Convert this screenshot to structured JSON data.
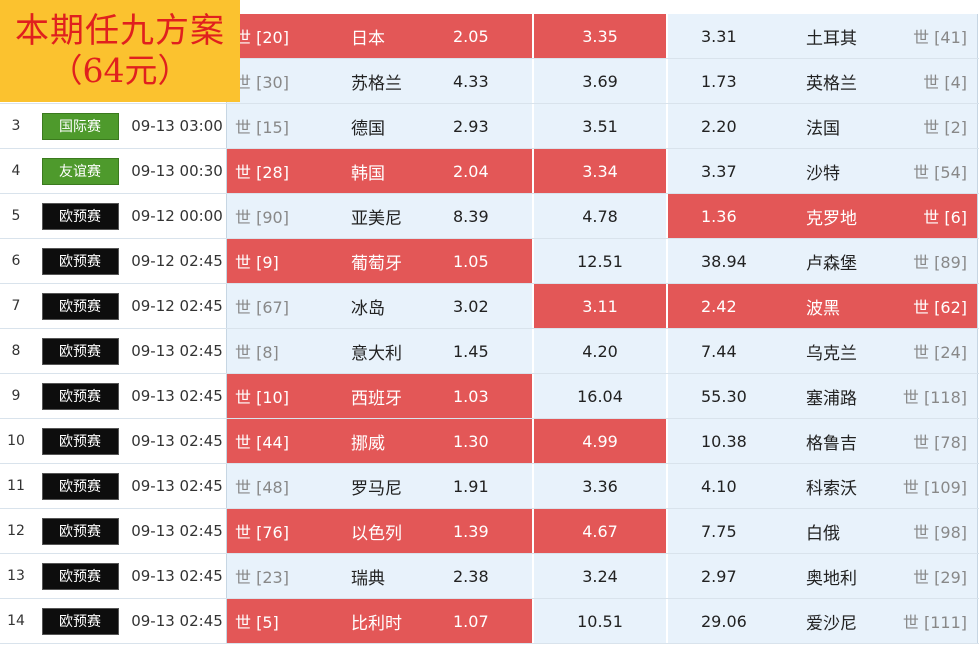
{
  "promo": {
    "line1": "本期任九方案",
    "line2": "（64元）"
  },
  "colors": {
    "highlight": "#e35757",
    "cell_blue": "#e8f2fb",
    "league_black": "#0d0d0d",
    "league_green": "#4e9a2c",
    "promo_bg": "#fbc22f",
    "promo_text": "#e0201e"
  },
  "rows": [
    {
      "num": "",
      "league": "",
      "league_color": "black",
      "time": "",
      "home_rank": "世 [20]",
      "home_team": "日本",
      "home_odd": "2.05",
      "draw_odd": "3.35",
      "away_odd": "3.31",
      "away_team": "土耳其",
      "away_rank": "世 [41]",
      "home_hl": true,
      "draw_hl": true,
      "away_hl": false
    },
    {
      "num": "",
      "league": "",
      "league_color": "black",
      "time": "",
      "home_rank": "世 [30]",
      "home_team": "苏格兰",
      "home_odd": "4.33",
      "draw_odd": "3.69",
      "away_odd": "1.73",
      "away_team": "英格兰",
      "away_rank": "世 [4]",
      "home_hl": false,
      "draw_hl": false,
      "away_hl": false
    },
    {
      "num": "3",
      "league": "国际赛",
      "league_color": "green",
      "time": "09-13 03:00",
      "home_rank": "世 [15]",
      "home_team": "德国",
      "home_odd": "2.93",
      "draw_odd": "3.51",
      "away_odd": "2.20",
      "away_team": "法国",
      "away_rank": "世 [2]",
      "home_hl": false,
      "draw_hl": false,
      "away_hl": false
    },
    {
      "num": "4",
      "league": "友谊赛",
      "league_color": "green",
      "time": "09-13 00:30",
      "home_rank": "世 [28]",
      "home_team": "韩国",
      "home_odd": "2.04",
      "draw_odd": "3.34",
      "away_odd": "3.37",
      "away_team": "沙特",
      "away_rank": "世 [54]",
      "home_hl": true,
      "draw_hl": true,
      "away_hl": false
    },
    {
      "num": "5",
      "league": "欧预赛",
      "league_color": "black",
      "time": "09-12 00:00",
      "home_rank": "世 [90]",
      "home_team": "亚美尼",
      "home_odd": "8.39",
      "draw_odd": "4.78",
      "away_odd": "1.36",
      "away_team": "克罗地",
      "away_rank": "世 [6]",
      "home_hl": false,
      "draw_hl": false,
      "away_hl": true
    },
    {
      "num": "6",
      "league": "欧预赛",
      "league_color": "black",
      "time": "09-12 02:45",
      "home_rank": "世 [9]",
      "home_team": "葡萄牙",
      "home_odd": "1.05",
      "draw_odd": "12.51",
      "away_odd": "38.94",
      "away_team": "卢森堡",
      "away_rank": "世 [89]",
      "home_hl": true,
      "draw_hl": false,
      "away_hl": false
    },
    {
      "num": "7",
      "league": "欧预赛",
      "league_color": "black",
      "time": "09-12 02:45",
      "home_rank": "世 [67]",
      "home_team": "冰岛",
      "home_odd": "3.02",
      "draw_odd": "3.11",
      "away_odd": "2.42",
      "away_team": "波黑",
      "away_rank": "世 [62]",
      "home_hl": false,
      "draw_hl": true,
      "away_hl": true
    },
    {
      "num": "8",
      "league": "欧预赛",
      "league_color": "black",
      "time": "09-13 02:45",
      "home_rank": "世 [8]",
      "home_team": "意大利",
      "home_odd": "1.45",
      "draw_odd": "4.20",
      "away_odd": "7.44",
      "away_team": "乌克兰",
      "away_rank": "世 [24]",
      "home_hl": false,
      "draw_hl": false,
      "away_hl": false
    },
    {
      "num": "9",
      "league": "欧预赛",
      "league_color": "black",
      "time": "09-13 02:45",
      "home_rank": "世 [10]",
      "home_team": "西班牙",
      "home_odd": "1.03",
      "draw_odd": "16.04",
      "away_odd": "55.30",
      "away_team": "塞浦路",
      "away_rank": "世 [118]",
      "home_hl": true,
      "draw_hl": false,
      "away_hl": false
    },
    {
      "num": "10",
      "league": "欧预赛",
      "league_color": "black",
      "time": "09-13 02:45",
      "home_rank": "世 [44]",
      "home_team": "挪威",
      "home_odd": "1.30",
      "draw_odd": "4.99",
      "away_odd": "10.38",
      "away_team": "格鲁吉",
      "away_rank": "世 [78]",
      "home_hl": true,
      "draw_hl": true,
      "away_hl": false
    },
    {
      "num": "11",
      "league": "欧预赛",
      "league_color": "black",
      "time": "09-13 02:45",
      "home_rank": "世 [48]",
      "home_team": "罗马尼",
      "home_odd": "1.91",
      "draw_odd": "3.36",
      "away_odd": "4.10",
      "away_team": "科索沃",
      "away_rank": "世 [109]",
      "home_hl": false,
      "draw_hl": false,
      "away_hl": false
    },
    {
      "num": "12",
      "league": "欧预赛",
      "league_color": "black",
      "time": "09-13 02:45",
      "home_rank": "世 [76]",
      "home_team": "以色列",
      "home_odd": "1.39",
      "draw_odd": "4.67",
      "away_odd": "7.75",
      "away_team": "白俄",
      "away_rank": "世 [98]",
      "home_hl": true,
      "draw_hl": true,
      "away_hl": false
    },
    {
      "num": "13",
      "league": "欧预赛",
      "league_color": "black",
      "time": "09-13 02:45",
      "home_rank": "世 [23]",
      "home_team": "瑞典",
      "home_odd": "2.38",
      "draw_odd": "3.24",
      "away_odd": "2.97",
      "away_team": "奥地利",
      "away_rank": "世 [29]",
      "home_hl": false,
      "draw_hl": false,
      "away_hl": false
    },
    {
      "num": "14",
      "league": "欧预赛",
      "league_color": "black",
      "time": "09-13 02:45",
      "home_rank": "世 [5]",
      "home_team": "比利时",
      "home_odd": "1.07",
      "draw_odd": "10.51",
      "away_odd": "29.06",
      "away_team": "爱沙尼",
      "away_rank": "世 [111]",
      "home_hl": true,
      "draw_hl": false,
      "away_hl": false
    }
  ]
}
